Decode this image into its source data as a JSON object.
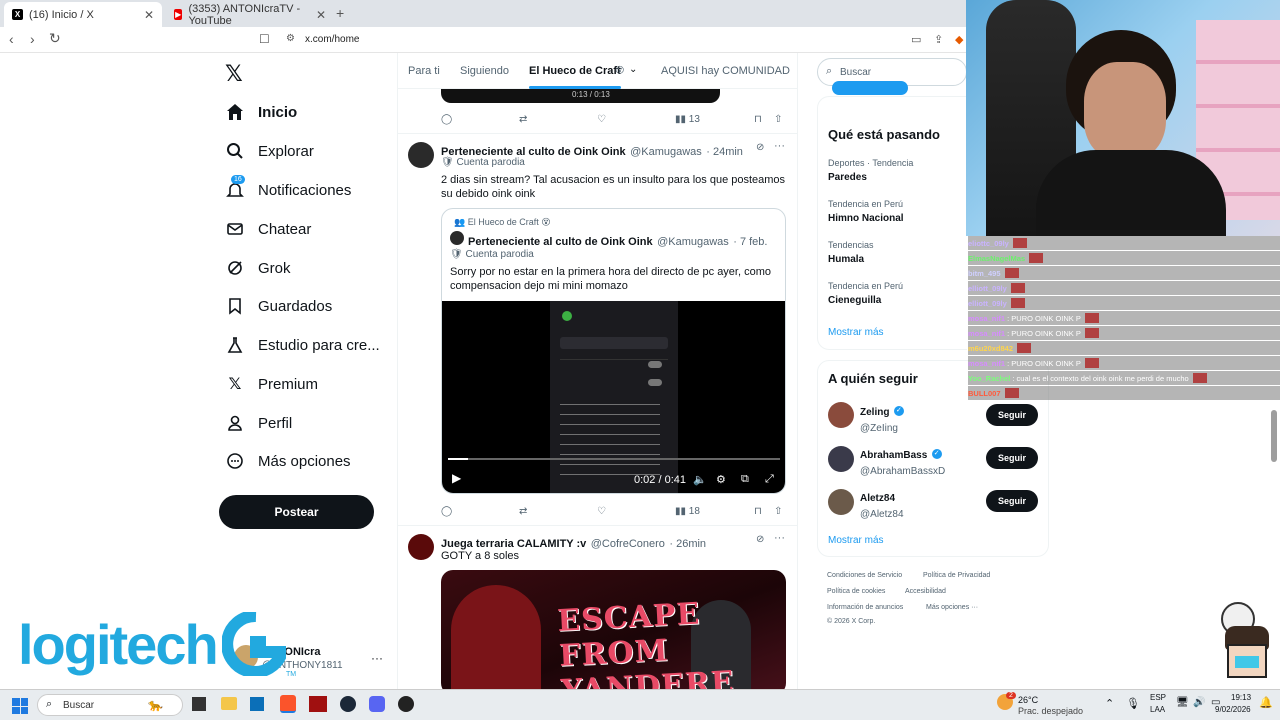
{
  "browser": {
    "tabs": [
      {
        "label": "(16) Inicio / X",
        "active": true
      },
      {
        "label": "(3353) ANTONIcraTV - YouTube",
        "active": false
      }
    ],
    "url": "x.com/home",
    "new_tab": "+"
  },
  "nav": {
    "items": [
      {
        "label": "Inicio",
        "icon": "home-icon"
      },
      {
        "label": "Explorar",
        "icon": "search-icon"
      },
      {
        "label": "Notificaciones",
        "icon": "bell-icon",
        "badge": "16"
      },
      {
        "label": "Chatear",
        "icon": "mail-icon"
      },
      {
        "label": "Grok",
        "icon": "grok-icon"
      },
      {
        "label": "Guardados",
        "icon": "bookmark-icon"
      },
      {
        "label": "Estudio para cre...",
        "icon": "flask-icon"
      },
      {
        "label": "Premium",
        "icon": "x-icon"
      },
      {
        "label": "Perfil",
        "icon": "person-icon"
      },
      {
        "label": "Más opciones",
        "icon": "more-circle-icon"
      }
    ],
    "post_button": "Postear",
    "account": {
      "name": "ANTONIcra",
      "handle": "@ANTHONY1811"
    }
  },
  "timeline": {
    "tabs": [
      "Para ti",
      "Siguiendo",
      "El Hueco de Craft",
      "AQUISI hay COMUNIDAD"
    ],
    "top_video_time": "0:13 / 0:13",
    "top_actions": {
      "views": "13"
    },
    "tweet1": {
      "name": "Perteneciente al culto de Oink Oink",
      "handle": "@Kamugawas",
      "time": "· 24min",
      "badge": "Cuenta parodia",
      "text": "2 dias sin stream? Tal acusacion es un insulto para los que posteamos su debido oink oink",
      "quote": {
        "community": "El Hueco de Craft",
        "name": "Perteneciente al culto de Oink Oink",
        "handle": "@Kamugawas",
        "time": "· 7 feb.",
        "badge": "Cuenta parodia",
        "text": "Sorry por no estar en la primera hora del directo de pc ayer, como compensacion dejo mi mini momazo"
      },
      "video_time": "0:02 / 0:41",
      "views": "18"
    },
    "tweet2": {
      "name": "Juega terraria CALAMITY :v",
      "handle": "@CofreConero",
      "time": "· 26min",
      "text": "GOTY a 8 soles",
      "image_title": "ESCAPE FROM YANDERE"
    }
  },
  "sidebar": {
    "search_placeholder": "Buscar",
    "trending_title": "Qué está pasando",
    "trends": [
      {
        "category": "Deportes · Tendencia",
        "name": "Paredes"
      },
      {
        "category": "Tendencia en Perú",
        "name": "Himno Nacional"
      },
      {
        "category": "Tendencias",
        "name": "Humala"
      },
      {
        "category": "Tendencia en Perú",
        "name": "Cieneguilla"
      }
    ],
    "show_more": "Mostrar más",
    "follow_title": "A quién seguir",
    "follow": [
      {
        "name": "Zeling",
        "handle": "@ZeIing",
        "button": "Seguir"
      },
      {
        "name": "AbrahamBass",
        "handle": "@AbrahamBassxD",
        "button": "Seguir"
      },
      {
        "name": "Aletz84",
        "handle": "@Aletz84",
        "button": "Seguir"
      }
    ],
    "follow_more": "Mostrar más",
    "footer": [
      "Condiciones de Servicio",
      "Política de Privacidad",
      "Política de cookies",
      "Accesibilidad",
      "Información de anuncios",
      "Más opciones ···",
      "© 2026 X Corp."
    ]
  },
  "chat": [
    {
      "user": "eliottc_09ly",
      "msg": "",
      "color": "#c9b3ff"
    },
    {
      "user": "ElmasNagelMas",
      "msg": "",
      "color": "#6cf06c"
    },
    {
      "user": "bitm_495",
      "msg": "",
      "color": "#cfcfff"
    },
    {
      "user": "elliott_09ly",
      "msg": "",
      "color": "#c9b3ff"
    },
    {
      "user": "elliott_09ly",
      "msg": "",
      "color": "#c9b3ff"
    },
    {
      "user": "mosa_nif1",
      "msg": ": PURO OINK OINK P",
      "color": "#d68bff"
    },
    {
      "user": "mosa_nif1",
      "msg": ": PURO OINK OINK P",
      "color": "#d68bff"
    },
    {
      "user": "m6u20xd842",
      "msg": "",
      "color": "#ffd54a"
    },
    {
      "user": "mosa_nif1",
      "msg": ": PURO OINK OINK P",
      "color": "#d68bff"
    },
    {
      "user": "Yoo_Rachel",
      "msg": ": cual es el contexto del oink oink me perdi de mucho",
      "color": "#7cfc7c"
    },
    {
      "user": "BULL007",
      "msg": "",
      "color": "#ff5a3c"
    }
  ],
  "overlay": {
    "brand": "logitech",
    "tm": "TM"
  },
  "taskbar": {
    "search": "Buscar",
    "weather_temp": "26°C",
    "weather_desc": "Prac. despejado",
    "weather_badge": "2",
    "lang1": "ESP",
    "lang2": "LAA",
    "time": "19:13",
    "date": "9/02/2026"
  },
  "colors": {
    "x_black": "#0f1419",
    "muted": "#536471",
    "link": "#1d9bf0",
    "verified": "#1d9bf0"
  }
}
